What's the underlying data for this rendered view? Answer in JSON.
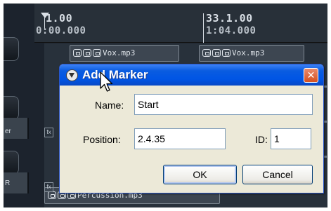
{
  "ruler": {
    "marker_bar": "1.00",
    "marker_time": "0:00.000",
    "second_bar": "33.1.00",
    "second_time": "1:04.000"
  },
  "tracks": {
    "row_labels": [
      "er",
      "R"
    ],
    "items": [
      {
        "name": "Vox.mp3"
      },
      {
        "name": "Vox.mp3"
      },
      {
        "name": "Percussion.mp3"
      }
    ],
    "fx_label": "fx"
  },
  "dialog": {
    "title": "Add Marker",
    "close_glyph": "✕",
    "name_label": "Name:",
    "name_value": "Start",
    "position_label": "Position:",
    "position_value": "2.4.35",
    "id_label": "ID:",
    "id_value": "1",
    "ok_label": "OK",
    "cancel_label": "Cancel"
  },
  "colors": {
    "titlebar": "#0055e5",
    "dialog_bg": "#ece9d8",
    "daw_bg": "#1e2530"
  },
  "icons": {
    "title_icon": "reaper-logo-icon",
    "close": "close-icon",
    "pointer": "mouse-pointer-icon"
  }
}
